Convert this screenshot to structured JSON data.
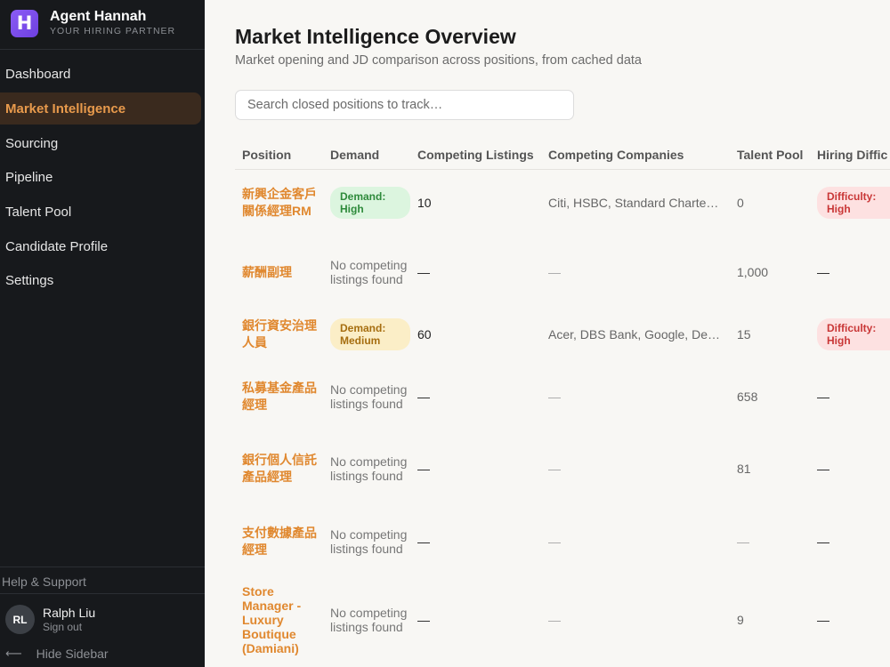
{
  "brand": {
    "name": "Agent Hannah",
    "tagline": "YOUR HIRING PARTNER",
    "logo_letter": "H"
  },
  "nav": [
    {
      "label": "Dashboard",
      "active": false
    },
    {
      "label": "Market Intelligence",
      "active": true
    },
    {
      "label": "Sourcing",
      "active": false
    },
    {
      "label": "Pipeline",
      "active": false
    },
    {
      "label": "Talent Pool",
      "active": false
    },
    {
      "label": "Candidate Profile",
      "active": false
    },
    {
      "label": "Settings",
      "active": false
    }
  ],
  "footer": {
    "help": "Help & Support",
    "user_initials": "RL",
    "user_name": "Ralph Liu",
    "sign_out": "Sign out",
    "hide_sidebar": "Hide Sidebar"
  },
  "main": {
    "title": "Market Intelligence Overview",
    "subtitle": "Market opening and JD comparison across positions, from cached data",
    "search_placeholder": "Search closed positions to track…"
  },
  "table": {
    "headers": [
      "Position",
      "Demand",
      "Competing Listings",
      "Competing Companies",
      "Talent Pool",
      "Hiring Diffic"
    ],
    "rows": [
      {
        "position": "新興企金客戶關係經理RM",
        "demand": "Demand: High",
        "demand_level": "high",
        "listings": "10",
        "companies": "Citi, HSBC, Standard Charte…",
        "talent_pool": "0",
        "difficulty": "Difficulty: High"
      },
      {
        "position": "薪酬副理",
        "demand": "No competing listings found",
        "demand_level": "none",
        "listings": "—",
        "companies": "—",
        "talent_pool": "1,000",
        "difficulty": "—"
      },
      {
        "position": "銀行資安治理人員",
        "demand": "Demand: Medium",
        "demand_level": "medium",
        "listings": "60",
        "companies": "Acer, DBS Bank, Google, Del…",
        "talent_pool": "15",
        "difficulty": "Difficulty: High"
      },
      {
        "position": "私募基金產品經理",
        "demand": "No competing listings found",
        "demand_level": "none",
        "listings": "—",
        "companies": "—",
        "talent_pool": "658",
        "difficulty": "—"
      },
      {
        "position": "銀行個人信託產品經理",
        "demand": "No competing listings found",
        "demand_level": "none",
        "listings": "—",
        "companies": "—",
        "talent_pool": "81",
        "difficulty": "—"
      },
      {
        "position": "支付數據產品經理",
        "demand": "No competing listings found",
        "demand_level": "none",
        "listings": "—",
        "companies": "—",
        "talent_pool": "—",
        "difficulty": "—"
      },
      {
        "position": "Store Manager - Luxury Boutique (Damiani)",
        "demand": "No competing listings found",
        "demand_level": "none",
        "listings": "—",
        "companies": "—",
        "talent_pool": "9",
        "difficulty": "—"
      }
    ]
  },
  "colors": {
    "accent": "#e0882f",
    "sidebar_bg": "#17191c",
    "main_bg": "#f8f7f4",
    "logo": "#7c4dea"
  },
  "icons": {
    "logo": "letter-h-logo-icon",
    "hide_sidebar": "arrow-left-icon"
  }
}
